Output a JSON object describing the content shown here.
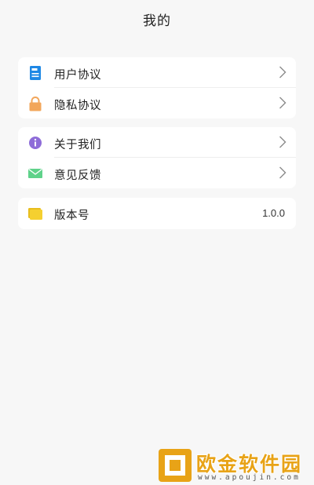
{
  "header": {
    "title": "我的"
  },
  "groups": [
    {
      "items": [
        {
          "label": "用户协议",
          "icon": "document-icon",
          "icon_color": "#1e88e5"
        },
        {
          "label": "隐私协议",
          "icon": "lock-icon",
          "icon_color": "#f2a65a"
        }
      ]
    },
    {
      "items": [
        {
          "label": "关于我们",
          "icon": "info-icon",
          "icon_color": "#8e6cd8"
        },
        {
          "label": "意见反馈",
          "icon": "mail-icon",
          "icon_color": "#5fd28a"
        }
      ]
    },
    {
      "items": [
        {
          "label": "版本号",
          "icon": "folder-icon",
          "icon_color": "#f5d030",
          "value": "1.0.0"
        }
      ]
    }
  ],
  "watermark": {
    "name": "欧金软件园",
    "url": "www.apoujin.com",
    "color": "#e8a317"
  }
}
